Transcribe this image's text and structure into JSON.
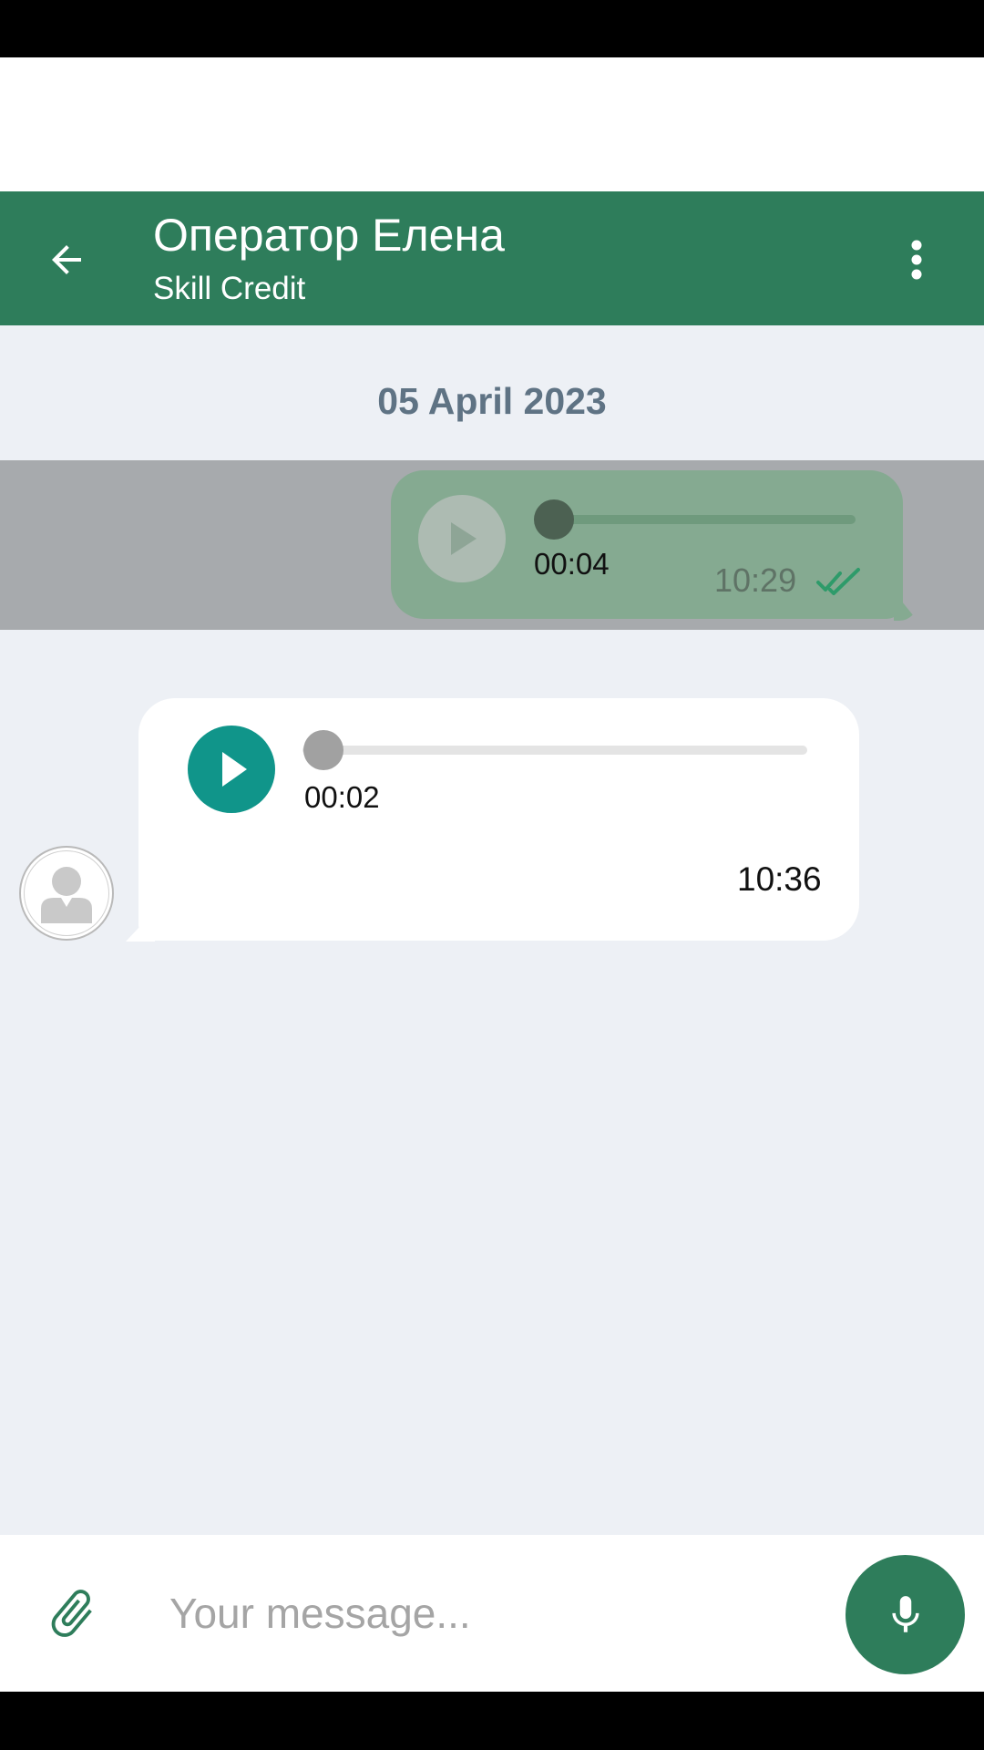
{
  "header": {
    "title": "Оператор Елена",
    "subtitle": "Skill Credit"
  },
  "chat": {
    "date_separator": "05 April 2023",
    "messages": [
      {
        "direction": "outgoing",
        "type": "voice",
        "duration": "00:04",
        "time": "10:29",
        "status": "read",
        "progress": 0,
        "highlighted": true
      },
      {
        "direction": "incoming",
        "type": "voice",
        "duration": "00:02",
        "time": "10:36",
        "progress": 0
      }
    ]
  },
  "composer": {
    "placeholder": "Your message...",
    "value": ""
  },
  "icons": {
    "back": "arrow-left-icon",
    "menu": "more-vertical-icon",
    "play": "play-icon",
    "read_status": "double-check-icon",
    "avatar": "user-placeholder-icon",
    "attach": "paperclip-icon",
    "mic": "microphone-icon"
  },
  "colors": {
    "header": "#2e7d5b",
    "chat_background": "#edf0f5",
    "outgoing_bubble": "#85aa91",
    "incoming_play": "#10958a",
    "read_ticks": "#2e9b6a",
    "date_text": "#5f7384"
  }
}
